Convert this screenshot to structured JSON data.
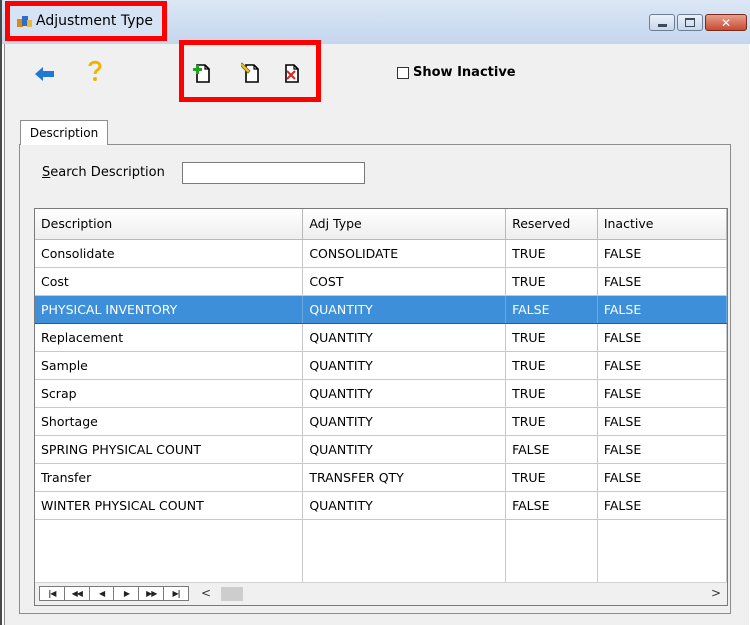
{
  "window": {
    "title": "Adjustment Type"
  },
  "toolbar": {
    "show_inactive_label": "Show Inactive"
  },
  "tabs": [
    {
      "label": "Description"
    }
  ],
  "search": {
    "label_first": "S",
    "label_rest": "earch Description",
    "value": ""
  },
  "grid": {
    "columns": [
      "Description",
      "Adj Type",
      "Reserved",
      "Inactive"
    ],
    "rows": [
      [
        "Consolidate",
        "CONSOLIDATE",
        "TRUE",
        "FALSE"
      ],
      [
        "Cost",
        "COST",
        "TRUE",
        "FALSE"
      ],
      [
        "PHYSICAL INVENTORY",
        "QUANTITY",
        "FALSE",
        "FALSE"
      ],
      [
        "Replacement",
        "QUANTITY",
        "TRUE",
        "FALSE"
      ],
      [
        "Sample",
        "QUANTITY",
        "TRUE",
        "FALSE"
      ],
      [
        "Scrap",
        "QUANTITY",
        "TRUE",
        "FALSE"
      ],
      [
        "Shortage",
        "QUANTITY",
        "TRUE",
        "FALSE"
      ],
      [
        "SPRING PHYSICAL COUNT",
        "QUANTITY",
        "FALSE",
        "FALSE"
      ],
      [
        "Transfer",
        "TRANSFER QTY",
        "TRUE",
        "FALSE"
      ],
      [
        "WINTER PHYSICAL COUNT",
        "QUANTITY",
        "FALSE",
        "FALSE"
      ]
    ],
    "selected_row": 2
  },
  "icons": {
    "title": "app-icon",
    "back": "back-arrow-icon",
    "help": "help-icon",
    "add": "add-record-icon",
    "edit": "edit-record-icon",
    "delete": "delete-record-icon"
  },
  "colors": {
    "selection": "#3d8fd9",
    "highlight_box": "#ff0000",
    "back_arrow": "#1e78d6",
    "help": "#f0b400",
    "add": "#22a022",
    "delete": "#e02020"
  }
}
